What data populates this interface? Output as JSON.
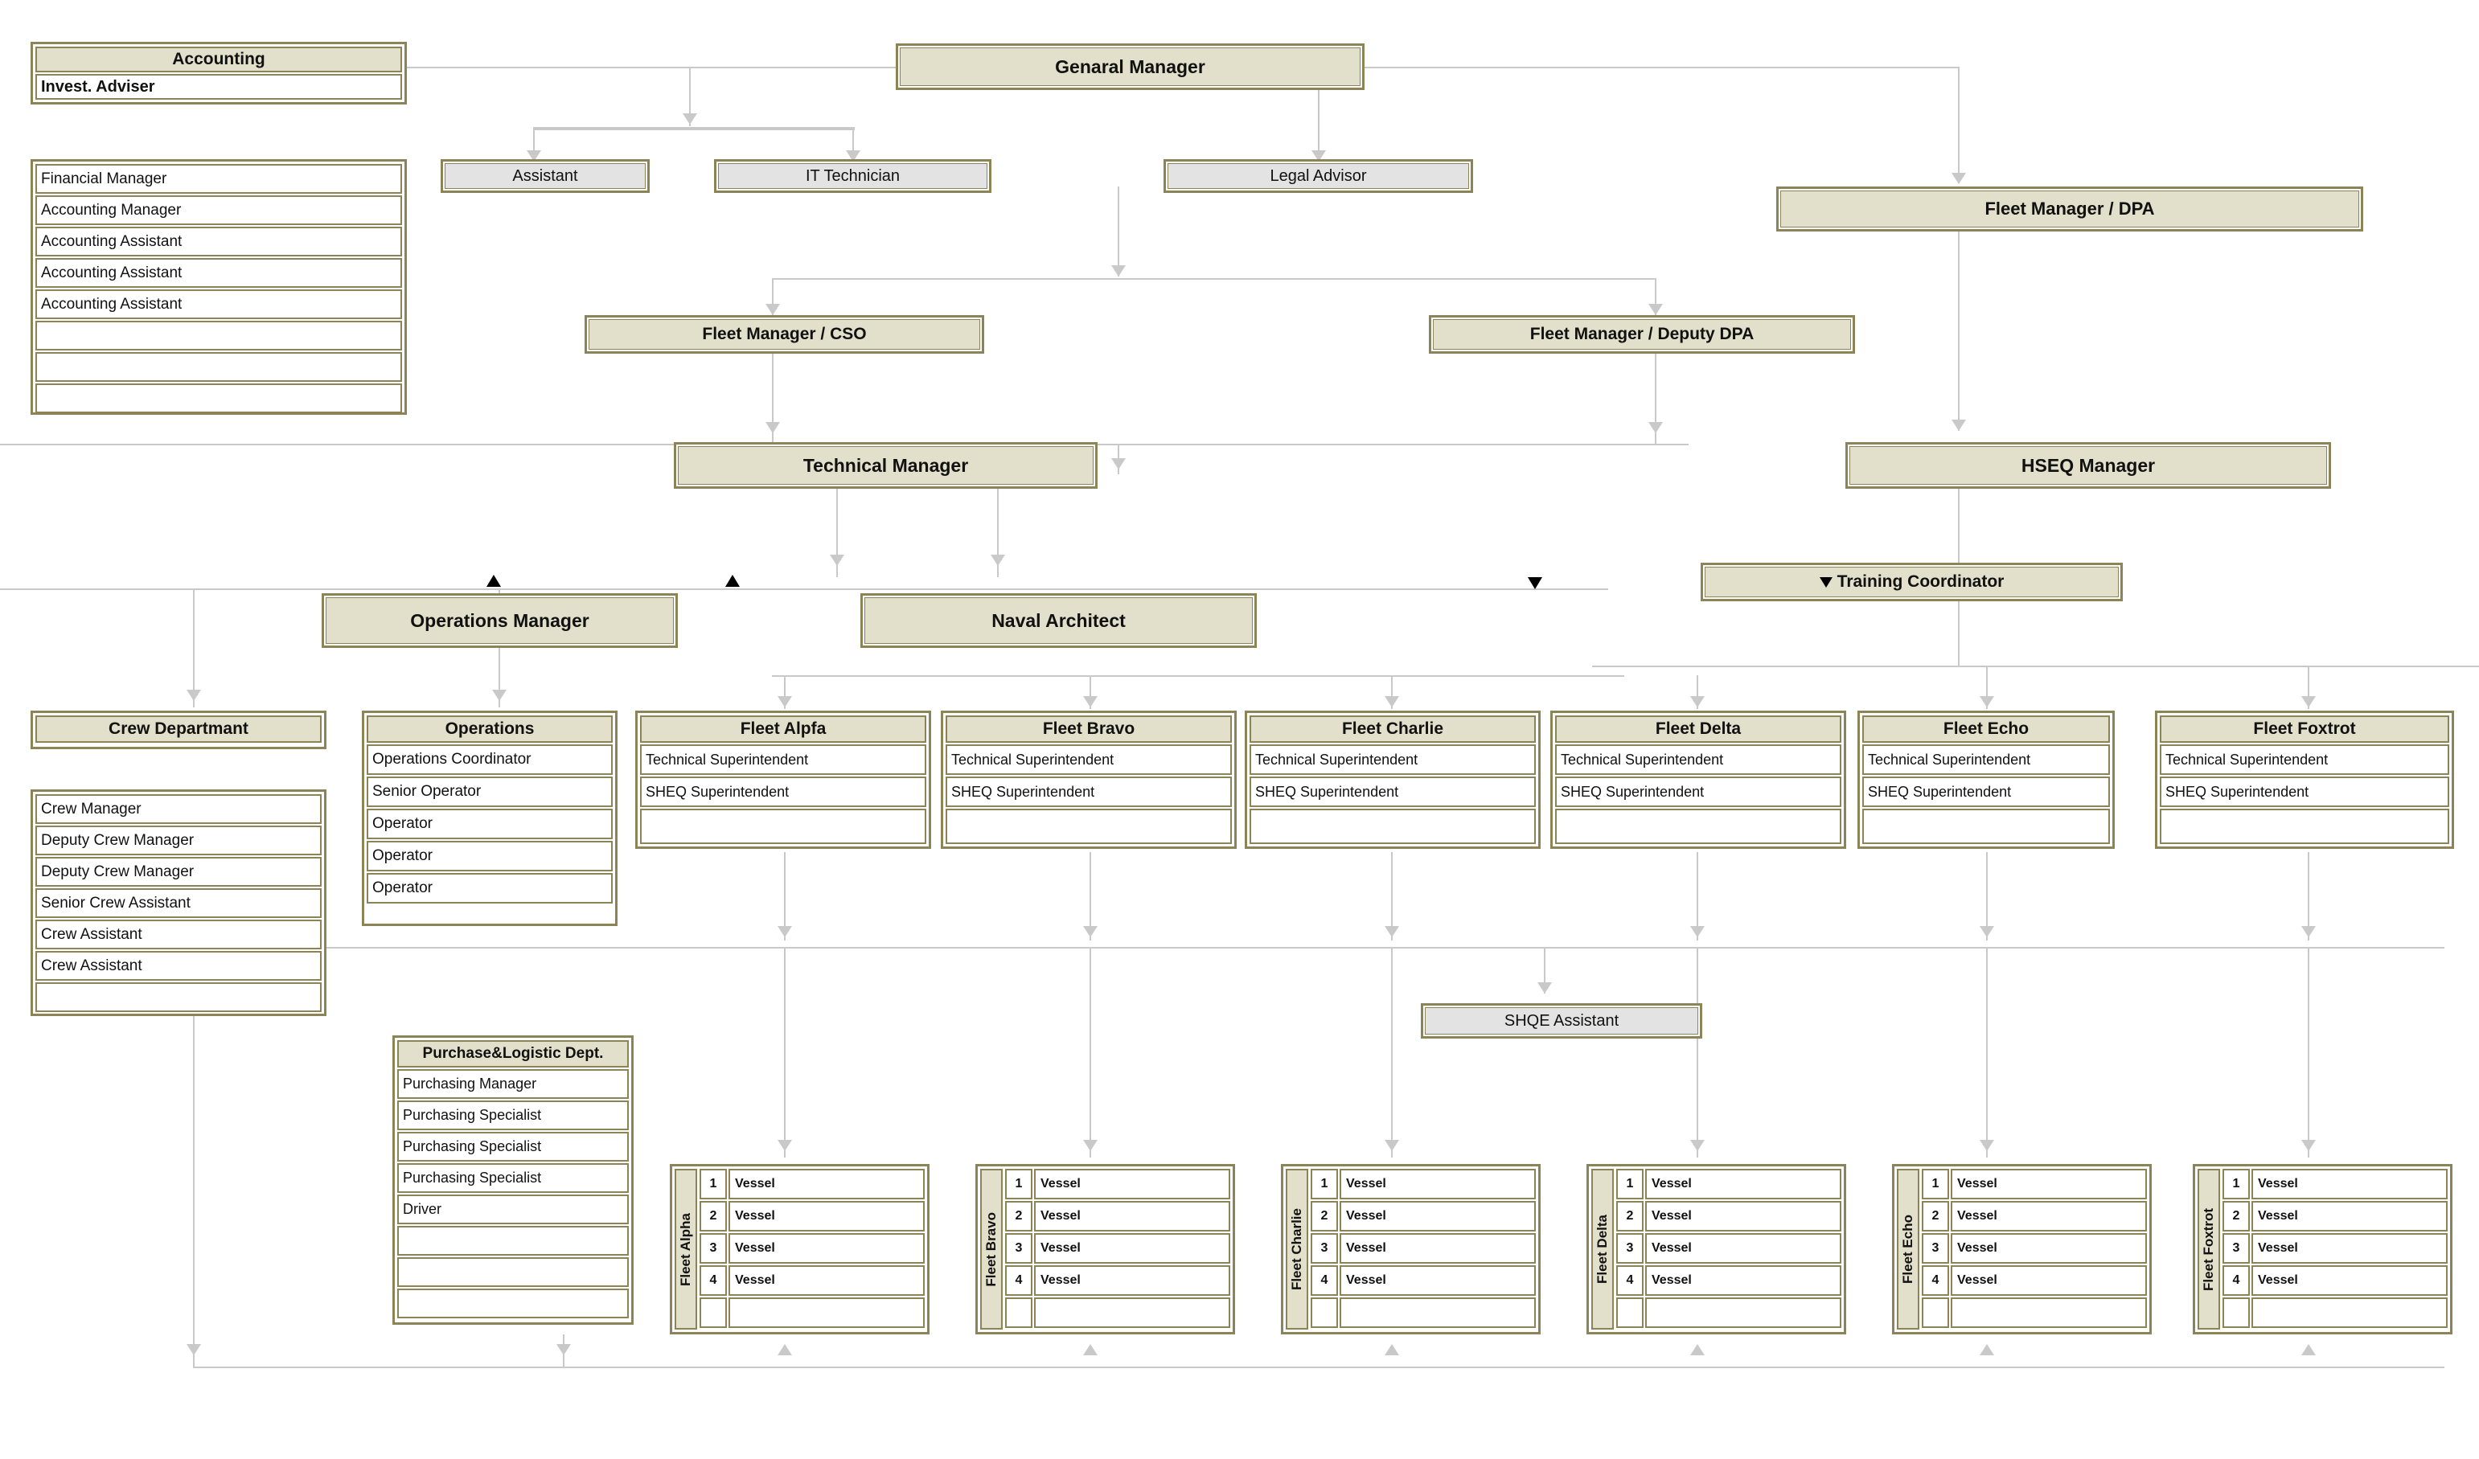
{
  "chart": {
    "type": "org-chart",
    "title": "Ship Management Company Organization Chart"
  },
  "colors": {
    "border": "#8C8457",
    "title_fill": "#E2E0CB",
    "staff_fill": "#E3E3E3",
    "cell_fill": "#FFFFFF",
    "connector": "#C9C9C9",
    "marker": "#000000"
  },
  "top": {
    "general_manager": "Genaral Manager",
    "assistant": "Assistant",
    "it_technician": "IT Technician",
    "legal_advisor": "Legal Advisor",
    "fleet_manager_dpa": "Fleet Manager / DPA"
  },
  "accounting": {
    "title": "Accounting",
    "subtitle": "Invest. Adviser",
    "roles": [
      "Financial Manager",
      "Accounting Manager",
      "Accounting Assistant",
      "Accounting Assistant",
      "Accounting Assistant",
      "",
      "",
      ""
    ]
  },
  "managers": {
    "fleet_manager_cso": "Fleet Manager / CSO",
    "fleet_manager_deputy_dpa": "Fleet Manager / Deputy DPA",
    "technical_manager": "Technical Manager",
    "hseq_manager": "HSEQ Manager",
    "training_coordinator": "Training Coordinator",
    "operations_manager": "Operations Manager",
    "naval_architect": "Naval Architect",
    "shqe_assistant": "SHQE Assistant"
  },
  "crew_department": {
    "title": "Crew Departmant",
    "roles": [
      "Crew Manager",
      "Deputy Crew Manager",
      "Deputy Crew Manager",
      "Senior Crew Assistant",
      "Crew Assistant",
      "Crew Assistant",
      ""
    ]
  },
  "operations_department": {
    "title": "Operations",
    "roles": [
      "Operations Coordinator",
      "Senior Operator",
      "Operator",
      "Operator",
      "Operator"
    ]
  },
  "purchase_department": {
    "title": "Purchase&Logistic Dept.",
    "roles": [
      "Purchasing Manager",
      "Purchasing Specialist",
      "Purchasing Specialist",
      "Purchasing Specialist",
      "Driver",
      "",
      "",
      ""
    ]
  },
  "fleets": [
    {
      "title": "Fleet Alpfa",
      "roles": [
        "Technical Superintendent",
        "SHEQ Superintendent",
        ""
      ]
    },
    {
      "title": "Fleet Bravo",
      "roles": [
        "Technical Superintendent",
        "SHEQ Superintendent",
        ""
      ]
    },
    {
      "title": "Fleet Charlie",
      "roles": [
        "Technical Superintendent",
        "SHEQ Superintendent",
        ""
      ]
    },
    {
      "title": "Fleet Delta",
      "roles": [
        "Technical Superintendent",
        "SHEQ Superintendent",
        ""
      ]
    },
    {
      "title": "Fleet Echo",
      "roles": [
        "Technical Superintendent",
        "SHEQ Superintendent",
        ""
      ]
    },
    {
      "title": "Fleet Foxtrot",
      "roles": [
        "Technical Superintendent",
        "SHEQ Superintendent",
        ""
      ]
    }
  ],
  "vessel_groups": [
    {
      "label": "Fleet Alpha",
      "rows": [
        {
          "n": "1",
          "name": "Vessel"
        },
        {
          "n": "2",
          "name": "Vessel"
        },
        {
          "n": "3",
          "name": "Vessel"
        },
        {
          "n": "4",
          "name": "Vessel"
        },
        {
          "n": "",
          "name": ""
        }
      ]
    },
    {
      "label": "Fleet Bravo",
      "rows": [
        {
          "n": "1",
          "name": "Vessel"
        },
        {
          "n": "2",
          "name": "Vessel"
        },
        {
          "n": "3",
          "name": "Vessel"
        },
        {
          "n": "4",
          "name": "Vessel"
        },
        {
          "n": "",
          "name": ""
        }
      ]
    },
    {
      "label": "Fleet Charlie",
      "rows": [
        {
          "n": "1",
          "name": "Vessel"
        },
        {
          "n": "2",
          "name": "Vessel"
        },
        {
          "n": "3",
          "name": "Vessel"
        },
        {
          "n": "4",
          "name": "Vessel"
        },
        {
          "n": "",
          "name": ""
        }
      ]
    },
    {
      "label": "Fleet Delta",
      "rows": [
        {
          "n": "1",
          "name": "Vessel"
        },
        {
          "n": "2",
          "name": "Vessel"
        },
        {
          "n": "3",
          "name": "Vessel"
        },
        {
          "n": "4",
          "name": "Vessel"
        },
        {
          "n": "",
          "name": ""
        }
      ]
    },
    {
      "label": "Fleet Echo",
      "rows": [
        {
          "n": "1",
          "name": "Vessel"
        },
        {
          "n": "2",
          "name": "Vessel"
        },
        {
          "n": "3",
          "name": "Vessel"
        },
        {
          "n": "4",
          "name": "Vessel"
        },
        {
          "n": "",
          "name": ""
        }
      ]
    },
    {
      "label": "Fleet Foxtrot",
      "rows": [
        {
          "n": "1",
          "name": "Vessel"
        },
        {
          "n": "2",
          "name": "Vessel"
        },
        {
          "n": "3",
          "name": "Vessel"
        },
        {
          "n": "4",
          "name": "Vessel"
        },
        {
          "n": "",
          "name": ""
        }
      ]
    }
  ]
}
